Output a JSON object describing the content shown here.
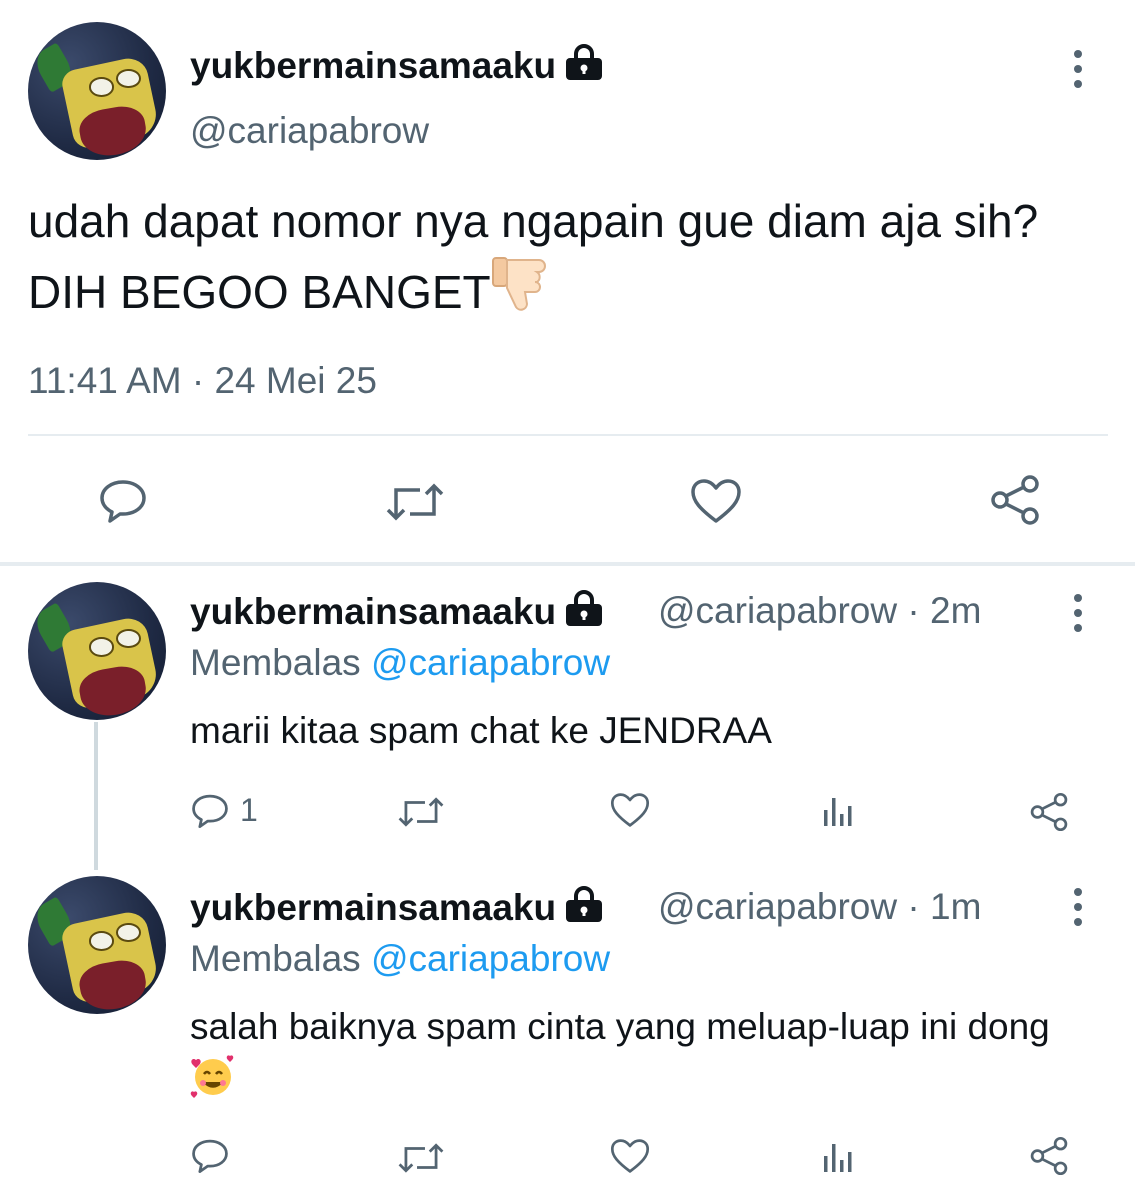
{
  "main_tweet": {
    "display_name": "yukbermainsamaaku",
    "handle": "@cariapabrow",
    "text": "udah dapat nomor nya ngapain gue diam aja sih? DIH BEGOO BANGET",
    "text_emoji": "thumbs-down",
    "timestamp": "11:41 AM · 24 Mei 25",
    "actions": [
      "reply-icon",
      "retweet-icon",
      "like-icon",
      "share-icon"
    ]
  },
  "replies": [
    {
      "display_name": "yukbermainsamaaku",
      "handle_time": "@cariapabrow · 2m",
      "replying_label": "Membalas",
      "replying_to": "@cariapabrow",
      "text": "marii kitaa spam chat ke JENDRAA",
      "reply_count": "1"
    },
    {
      "display_name": "yukbermainsamaaku",
      "handle_time": "@cariapabrow · 1m",
      "replying_label": "Membalas",
      "replying_to": "@cariapabrow",
      "text": "salah baiknya spam cinta yang meluap-luap ini dong",
      "text_emoji": "smiling-face-with-hearts"
    }
  ],
  "colors": {
    "text": "#0f1419",
    "secondary": "#536471",
    "link": "#1d9bf0",
    "divider": "#e6ecf0"
  }
}
